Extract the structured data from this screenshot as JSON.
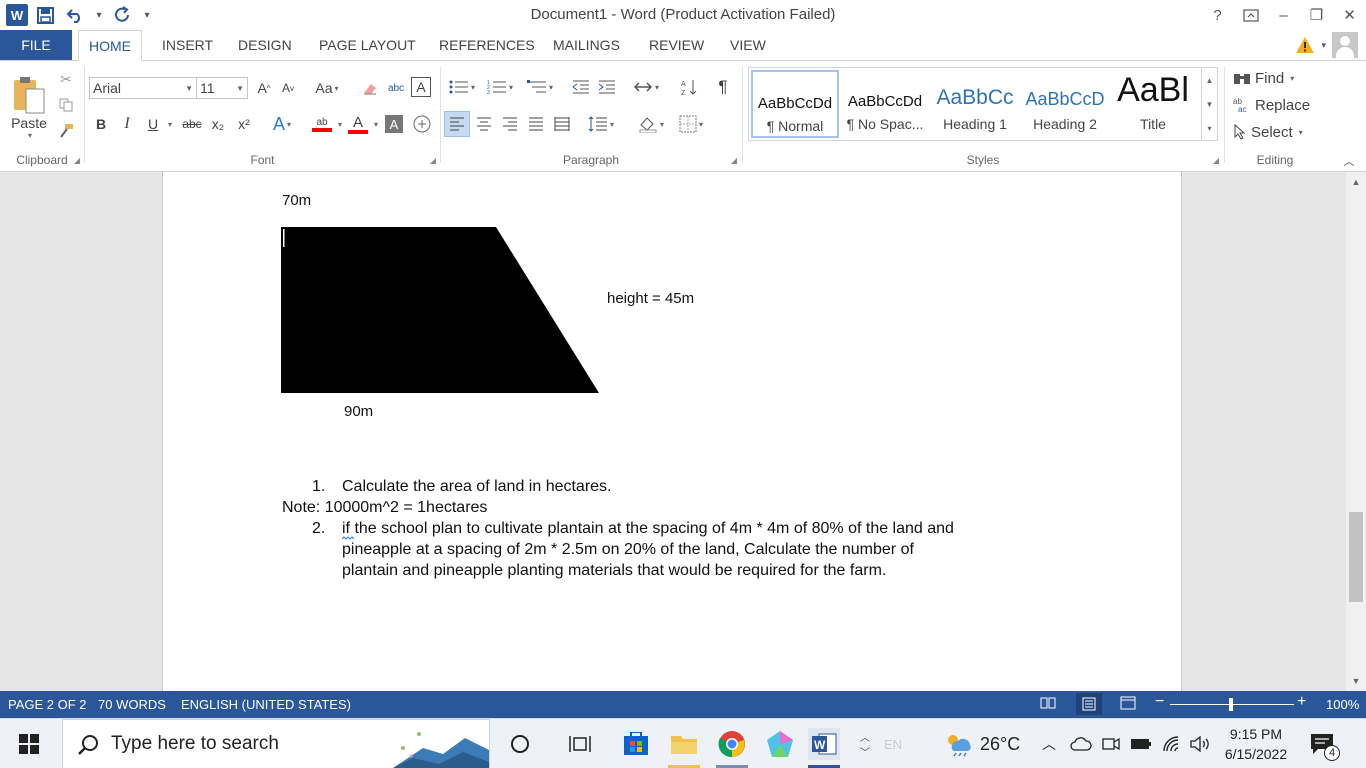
{
  "title_bar": {
    "app_icon_letter": "W",
    "document_title": "Document1 - Word (Product Activation Failed)",
    "help": "?",
    "window_controls": [
      "–",
      "❐",
      "✕"
    ]
  },
  "tabs": {
    "file": "FILE",
    "items": [
      "HOME",
      "INSERT",
      "DESIGN",
      "PAGE LAYOUT",
      "REFERENCES",
      "MAILINGS",
      "REVIEW",
      "VIEW"
    ],
    "active": "HOME"
  },
  "ribbon": {
    "clipboard": {
      "paste_label": "Paste",
      "group_label": "Clipboard"
    },
    "font": {
      "font_name": "Arial",
      "font_size": "11",
      "grow": "A",
      "shrink": "A",
      "change_case": "Aa",
      "bold": "B",
      "italic": "I",
      "underline": "U",
      "strike": "abc",
      "subscript": "x₂",
      "superscript": "x²",
      "highlight_color": "#ff0000",
      "font_color": "#ff0000",
      "group_label": "Font"
    },
    "paragraph": {
      "group_label": "Paragraph",
      "pilcrow": "¶"
    },
    "styles": {
      "group_label": "Styles",
      "items": [
        {
          "sample": "AaBbCcDd",
          "name": "¶ Normal"
        },
        {
          "sample": "AaBbCcDd",
          "name": "¶ No Spac..."
        },
        {
          "sample": "AaBbCc",
          "name": "Heading 1"
        },
        {
          "sample": "AaBbCcD",
          "name": "Heading 2"
        },
        {
          "sample": "AaBl",
          "name": "Title"
        }
      ]
    },
    "editing": {
      "find": "Find",
      "replace": "Replace",
      "select": "Select",
      "group_label": "Editing"
    }
  },
  "document": {
    "top_label": "70m",
    "height_label": "height = 45m",
    "bottom_label": "90m",
    "item1_number": "1.",
    "item1_text": "Calculate the area of land in hectares.",
    "note": "Note: 10000m^2 = 1hectares",
    "item2_number": "2.",
    "item2_lines": [
      "if the school plan to cultivate plantain at the spacing of 4m * 4m of 80% of the land and",
      "pineapple at a spacing of 2m * 2.5m on 20% of the land, Calculate the number of",
      "plantain and pineapple planting materials that would be required for the farm."
    ]
  },
  "status_bar": {
    "page": "PAGE 2 OF 2",
    "words": "70 WORDS",
    "language": "ENGLISH (UNITED STATES)",
    "zoom": "100%"
  },
  "taskbar": {
    "search_placeholder": "Type here to search",
    "language": "EN",
    "temperature": "26°C",
    "time": "9:15 PM",
    "date": "6/15/2022",
    "notifications": "4"
  },
  "colors": {
    "accent": "#2b579a",
    "page": "#ffffff",
    "trapezoid": "#000000"
  }
}
